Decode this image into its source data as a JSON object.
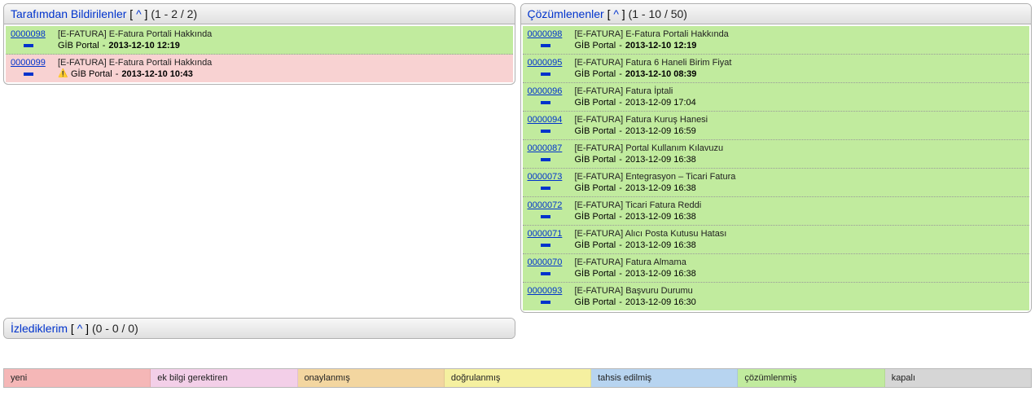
{
  "panels": {
    "reported": {
      "title": "Tarafımdan Bildirilenler",
      "caret": "^",
      "counts": "(1 - 2 / 2)",
      "items": [
        {
          "id": "0000098",
          "title": "[E-FATURA] E-Fatura Portali Hakkında",
          "project": "GİB Portal",
          "date": "2013-12-10 12:19",
          "bold": true,
          "bg": "bg-lime",
          "warn": false
        },
        {
          "id": "0000099",
          "title": "[E-FATURA] E-Fatura Portali Hakkında",
          "project": "GİB Portal",
          "date": "2013-12-10 10:43",
          "bold": true,
          "bg": "bg-rose",
          "warn": true
        }
      ]
    },
    "resolved": {
      "title": "Çözümlenenler",
      "caret": "^",
      "counts": "(1 - 10 / 50)",
      "items": [
        {
          "id": "0000098",
          "title": "[E-FATURA] E-Fatura Portali Hakkında",
          "project": "GİB Portal",
          "date": "2013-12-10 12:19",
          "bold": true,
          "bg": "bg-lime",
          "warn": false
        },
        {
          "id": "0000095",
          "title": "[E-FATURA] Fatura 6 Haneli Birim Fiyat",
          "project": "GİB Portal",
          "date": "2013-12-10 08:39",
          "bold": true,
          "bg": "bg-lime",
          "warn": false
        },
        {
          "id": "0000096",
          "title": "[E-FATURA] Fatura İptali",
          "project": "GİB Portal",
          "date": "2013-12-09 17:04",
          "bold": false,
          "bg": "bg-lime",
          "warn": false
        },
        {
          "id": "0000094",
          "title": "[E-FATURA] Fatura Kuruş Hanesi",
          "project": "GİB Portal",
          "date": "2013-12-09 16:59",
          "bold": false,
          "bg": "bg-lime",
          "warn": false
        },
        {
          "id": "0000087",
          "title": "[E-FATURA] Portal Kullanım Kılavuzu",
          "project": "GİB Portal",
          "date": "2013-12-09 16:38",
          "bold": false,
          "bg": "bg-lime",
          "warn": false
        },
        {
          "id": "0000073",
          "title": "[E-FATURA] Entegrasyon – Ticari Fatura",
          "project": "GİB Portal",
          "date": "2013-12-09 16:38",
          "bold": false,
          "bg": "bg-lime",
          "warn": false
        },
        {
          "id": "0000072",
          "title": "[E-FATURA] Ticari Fatura Reddi",
          "project": "GİB Portal",
          "date": "2013-12-09 16:38",
          "bold": false,
          "bg": "bg-lime",
          "warn": false
        },
        {
          "id": "0000071",
          "title": "[E-FATURA] Alıcı Posta Kutusu Hatası",
          "project": "GİB Portal",
          "date": "2013-12-09 16:38",
          "bold": false,
          "bg": "bg-lime",
          "warn": false
        },
        {
          "id": "0000070",
          "title": "[E-FATURA] Fatura Almama",
          "project": "GİB Portal",
          "date": "2013-12-09 16:38",
          "bold": false,
          "bg": "bg-lime",
          "warn": false
        },
        {
          "id": "0000093",
          "title": "[E-FATURA] Başvuru Durumu",
          "project": "GİB Portal",
          "date": "2013-12-09 16:30",
          "bold": false,
          "bg": "bg-lime",
          "warn": false
        }
      ]
    },
    "watched": {
      "title": "İzlediklerim",
      "caret": "^",
      "counts": "(0 - 0 / 0)",
      "items": []
    }
  },
  "separator": " - ",
  "warn_glyph": "⚠️",
  "legend": [
    {
      "label": "yeni",
      "cls": "c-new"
    },
    {
      "label": "ek bilgi gerektiren",
      "cls": "c-feedback"
    },
    {
      "label": "onaylanmış",
      "cls": "c-ack"
    },
    {
      "label": "doğrulanmış",
      "cls": "c-confirm"
    },
    {
      "label": "tahsis edilmiş",
      "cls": "c-assigned"
    },
    {
      "label": "çözümlenmiş",
      "cls": "c-resolved"
    },
    {
      "label": "kapalı",
      "cls": "c-closed"
    }
  ]
}
